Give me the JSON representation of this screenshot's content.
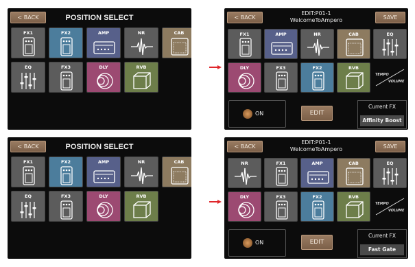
{
  "common": {
    "back_label": "< BACK",
    "save_label": "SAVE",
    "position_select_title": "POSITION SELECT",
    "edit_label": "EDIT",
    "on_label": "ON",
    "current_fx_label": "Current FX",
    "tempo_label": "TEMPO",
    "volume_label": "VOLUME"
  },
  "panel1": {
    "tiles": [
      {
        "label": "FX1",
        "icon": "pedal-icon",
        "color": "#5c5c5c"
      },
      {
        "label": "FX2",
        "icon": "pedal-icon",
        "color": "#4c7d9c"
      },
      {
        "label": "AMP",
        "icon": "amp-icon",
        "color": "#57608a"
      },
      {
        "label": "NR",
        "icon": "waveform-icon",
        "color": "#5c5c5c"
      },
      {
        "label": "CAB",
        "icon": "cab-icon",
        "color": "#8d7b60"
      },
      {
        "label": "EQ",
        "icon": "eq-sliders-icon",
        "color": "#5c5c5c"
      },
      {
        "label": "FX3",
        "icon": "pedal-icon",
        "color": "#5c5c5c"
      },
      {
        "label": "DLY",
        "icon": "delay-rings-icon",
        "color": "#9c4a72"
      },
      {
        "label": "RVB",
        "icon": "reverb-cube-icon",
        "color": "#6d7e4a"
      }
    ]
  },
  "panel2": {
    "edit_title": "EDIT:P01-1",
    "preset_name": "WelcomeToAmpero",
    "current_fx_value": "Affinity Boost",
    "tiles": [
      {
        "label": "FX1",
        "icon": "pedal-icon",
        "color": "#5c5c5c"
      },
      {
        "label": "AMP",
        "icon": "amp-icon",
        "color": "#57608a"
      },
      {
        "label": "NR",
        "icon": "waveform-icon",
        "color": "#5c5c5c"
      },
      {
        "label": "CAB",
        "icon": "cab-icon",
        "color": "#8d7b60"
      },
      {
        "label": "EQ",
        "icon": "eq-sliders-icon",
        "color": "#5c5c5c"
      },
      {
        "label": "DLY",
        "icon": "delay-rings-icon",
        "color": "#9c4a72"
      },
      {
        "label": "FX3",
        "icon": "pedal-icon",
        "color": "#5c5c5c"
      },
      {
        "label": "FX2",
        "icon": "pedal-icon",
        "color": "#4c7d9c"
      },
      {
        "label": "RVB",
        "icon": "reverb-cube-icon",
        "color": "#6d7e4a"
      }
    ]
  },
  "panel3": {
    "tiles": [
      {
        "label": "FX1",
        "icon": "pedal-icon",
        "color": "#5c5c5c"
      },
      {
        "label": "FX2",
        "icon": "pedal-icon",
        "color": "#4c7d9c"
      },
      {
        "label": "AMP",
        "icon": "amp-icon",
        "color": "#57608a"
      },
      {
        "label": "NR",
        "icon": "waveform-icon",
        "color": "#5c5c5c"
      },
      {
        "label": "CAB",
        "icon": "cab-icon",
        "color": "#8d7b60"
      },
      {
        "label": "EQ",
        "icon": "eq-sliders-icon",
        "color": "#5c5c5c"
      },
      {
        "label": "FX3",
        "icon": "pedal-icon",
        "color": "#5c5c5c"
      },
      {
        "label": "DLY",
        "icon": "delay-rings-icon",
        "color": "#9c4a72"
      },
      {
        "label": "RVB",
        "icon": "reverb-cube-icon",
        "color": "#6d7e4a"
      }
    ]
  },
  "panel4": {
    "edit_title": "EDIT:P01-1",
    "preset_name": "WelcomeToAmpero",
    "current_fx_value": "Fast Gate",
    "tiles": [
      {
        "label": "NR",
        "icon": "waveform-icon",
        "color": "#5c5c5c"
      },
      {
        "label": "FX1",
        "icon": "pedal-icon",
        "color": "#5c5c5c"
      },
      {
        "label": "AMP",
        "icon": "amp-icon",
        "color": "#57608a"
      },
      {
        "label": "CAB",
        "icon": "cab-icon",
        "color": "#8d7b60"
      },
      {
        "label": "EQ",
        "icon": "eq-sliders-icon",
        "color": "#5c5c5c"
      },
      {
        "label": "DLY",
        "icon": "delay-rings-icon",
        "color": "#9c4a72"
      },
      {
        "label": "FX3",
        "icon": "pedal-icon",
        "color": "#5c5c5c"
      },
      {
        "label": "FX2",
        "icon": "pedal-icon",
        "color": "#4c7d9c"
      },
      {
        "label": "RVB",
        "icon": "reverb-cube-icon",
        "color": "#6d7e4a"
      }
    ]
  },
  "colors": {
    "arrow": "#e0262b",
    "button": "#8a6d55",
    "selected_outline": "#ffffff"
  }
}
